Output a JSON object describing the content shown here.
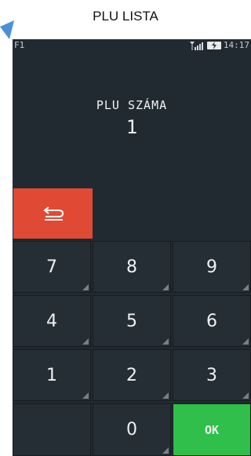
{
  "page_title": "PLU LISTA",
  "status": {
    "left": "F1",
    "time": "14:17"
  },
  "display": {
    "label": "PLU SZÁMA",
    "value": "1"
  },
  "keys": {
    "k7": "7",
    "k8": "8",
    "k9": "9",
    "k4": "4",
    "k5": "5",
    "k6": "6",
    "k1": "1",
    "k2": "2",
    "k3": "3",
    "k0": "0",
    "ok": "OK"
  },
  "colors": {
    "screen_bg": "#222a31",
    "back_button": "#e04a34",
    "ok_button": "#2fbf4a"
  },
  "icons": {
    "back": "return-arrow-icon",
    "signal": "signal-icon",
    "battery": "battery-charging-icon",
    "corner": "corner-arrow-icon"
  }
}
